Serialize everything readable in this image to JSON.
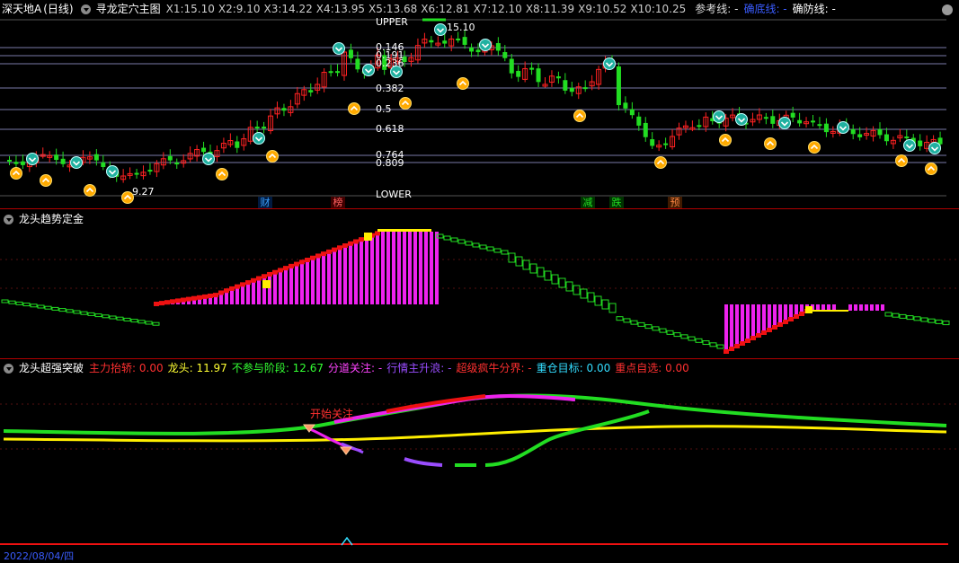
{
  "main": {
    "stock_name": "深天地A",
    "period": "(日线)",
    "indicator": "寻龙定穴主图",
    "x_values": [
      {
        "label": "X1:",
        "value": "15.10"
      },
      {
        "label": "X2:",
        "value": "9.10"
      },
      {
        "label": "X3:",
        "value": "14.22"
      },
      {
        "label": "X4:",
        "value": "13.95"
      },
      {
        "label": "X5:",
        "value": "13.68"
      },
      {
        "label": "X6:",
        "value": "12.81"
      },
      {
        "label": "X7:",
        "value": "12.10"
      },
      {
        "label": "X8:",
        "value": "11.39"
      },
      {
        "label": "X9:",
        "value": "10.52"
      },
      {
        "label": "X10:",
        "value": "10.25"
      }
    ],
    "ref_line": "参考线: -",
    "bottom_line": "确底线: -",
    "guard_line": "确防线: -",
    "upper_label": "UPPER",
    "lower_label": "LOWER",
    "high_label": "15.10",
    "low_label": "9.27",
    "fib_levels": [
      "0.146",
      "0.191",
      "0.236",
      "0.382",
      "0.5",
      "0.618",
      "0.764",
      "0.809"
    ],
    "events": [
      {
        "text": "财",
        "color": "#3aa0ff",
        "bg": "#001a40"
      },
      {
        "text": "榜",
        "color": "#ff6060",
        "bg": "#400000"
      },
      {
        "text": "减",
        "color": "#22dd22",
        "bg": "#003300"
      },
      {
        "text": "跌",
        "color": "#22dd22",
        "bg": "#003300"
      },
      {
        "text": "预",
        "color": "#ff8844",
        "bg": "#401a00"
      }
    ]
  },
  "panel2": {
    "title": "龙头趋势定金"
  },
  "panel3": {
    "title": "龙头超强突破",
    "items": [
      {
        "label": "主力抬轿:",
        "value": "0.00",
        "color": "#ff3030"
      },
      {
        "label": "龙头:",
        "value": "11.97",
        "color": "#ffff33"
      },
      {
        "label": "不参与阶段:",
        "value": "12.67",
        "color": "#33ff33"
      },
      {
        "label": "分道关注:",
        "value": "-",
        "color": "#ff44ff"
      },
      {
        "label": "行情主升浪:",
        "value": "-",
        "color": "#9a4dff"
      },
      {
        "label": "超级疯牛分界:",
        "value": "-",
        "color": "#ff3030"
      },
      {
        "label": "重仓目标:",
        "value": "0.00",
        "color": "#33ddff"
      },
      {
        "label": "重点自选:",
        "value": "0.00",
        "color": "#ff3030"
      }
    ],
    "annotation": "开始关注",
    "date_label": "2022/08/04/四"
  },
  "colors": {
    "up": "#ff2222",
    "down": "#00e0e0",
    "green": "#22dd22",
    "magenta": "#ee22ee",
    "yellow": "#ffee00",
    "separator": "#b00000"
  }
}
